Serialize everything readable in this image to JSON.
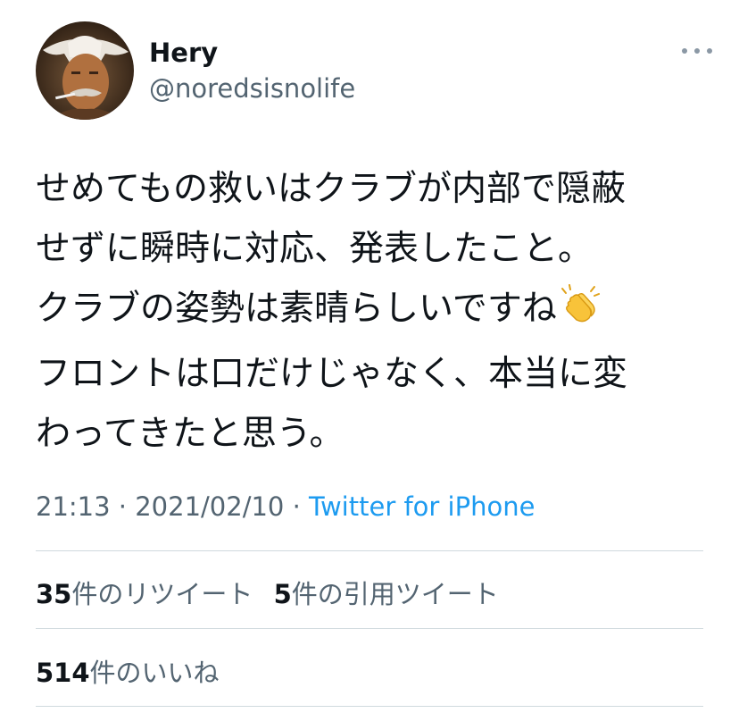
{
  "tweet": {
    "author": {
      "name": "Hery",
      "handle": "@noredsisnolife"
    },
    "text_lines": [
      "せめてもの救いはクラブが内部で隠蔽",
      "せずに瞬時に対応、発表したこと。",
      "クラブの姿勢は素晴らしいですね",
      "フロントは口だけじゃなく、本当に変",
      "わってきたと思う。"
    ],
    "emoji": "clapping-hands",
    "time": "21:13",
    "date": "2021/02/10",
    "separator": "·",
    "source": "Twitter for iPhone",
    "stats": {
      "retweets_count": "35",
      "retweets_label": "件のリツイート",
      "quotes_count": "5",
      "quotes_label": "件の引用ツイート",
      "likes_count": "514",
      "likes_label": "件のいいね"
    }
  },
  "icons": {
    "more": "more-horizontal-icon",
    "avatar": "user-avatar"
  },
  "colors": {
    "text": "#0f1419",
    "secondary": "#536471",
    "link": "#1d9bf0",
    "divider": "#cfd9de"
  }
}
